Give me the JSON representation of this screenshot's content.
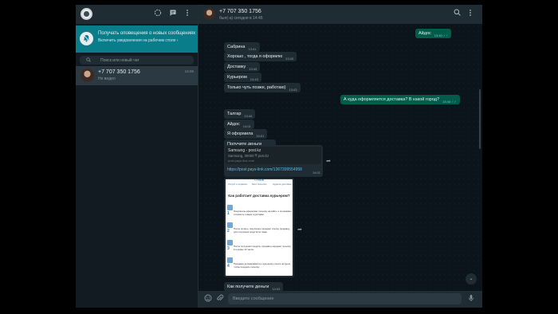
{
  "sidebar": {
    "notice_title": "Получать оповещения о новых сообщениях",
    "notice_sub": "Включить уведомления на рабочем столе ›",
    "search_placeholder": "Поиск или новый чат",
    "chat": {
      "name": "+7 707 350 1756",
      "last": "Не видел",
      "time": "14:46"
    }
  },
  "header": {
    "name": "+7 707 350 1756",
    "status": "был(-а) сегодня в 14:45"
  },
  "messages": [
    {
      "text": "Айдос",
      "time": "13:40",
      "dir": "out"
    },
    {
      "text": "Сабрина",
      "time": "13:41",
      "dir": "in"
    },
    {
      "text": "Хорошо , тогда я оформлю",
      "time": "13:43",
      "dir": "in"
    },
    {
      "text": "Доставку",
      "time": "13:43",
      "dir": "in"
    },
    {
      "text": "Курьером",
      "time": "13:43",
      "dir": "in"
    },
    {
      "text": "Только чуть позже, работаю)",
      "time": "13:43",
      "dir": "in"
    },
    {
      "text": "А куда оформляется доставка? В какой город?",
      "time": "13:44",
      "dir": "out"
    },
    {
      "text": "Талгар",
      "time": "13:44",
      "dir": "in"
    },
    {
      "text": "Айдос",
      "time": "14:01",
      "dir": "in"
    },
    {
      "text": "Я оформила",
      "time": "14:01",
      "dir": "in"
    },
    {
      "text": "Получите деньги",
      "time": "14:01",
      "dir": "in"
    },
    {
      "text": "Как получите деньги",
      "time": "14:03",
      "dir": "in"
    }
  ],
  "link_card": {
    "title": "Samsung - post.kz",
    "desc": "Samsung, 30000 ₸ post.kz",
    "domain": "post.pays-link.com",
    "url": "https://post.pays-link.com/1367399554958",
    "time": "14:01"
  },
  "image_card": {
    "tabs": [
      "Услуги и сервисы",
      "Мои посылки",
      "Адреса доставки"
    ],
    "cut_title": "Отзыв",
    "title": "Как работает доставка курьером?",
    "steps": [
      {
        "num": "1",
        "text": "Покупатель оформляет посылку на сайте, и оплачивает стоимость товара и доставки."
      },
      {
        "num": "2",
        "text": "После оплаты, покупатель передает ссылку продавцу, для получения средств за товар."
      },
      {
        "num": "3",
        "text": "После получения средств, продавец передает посылку в течение 12 часов."
      },
      {
        "num": "4",
        "text": "Продавец договаривается с курьером о месте встречи, чтобы передать посылку."
      }
    ]
  },
  "composer": {
    "placeholder": "Введите сообщение"
  },
  "icons": [
    "status-icon",
    "new-chat-icon",
    "menu-icon",
    "bell-off-icon",
    "search-icon",
    "emoji-icon",
    "attach-icon",
    "mic-icon",
    "forward-icon",
    "chevron-down-icon"
  ],
  "colors": {
    "accent": "#0a7d8a",
    "outgoing": "#005c4b",
    "incoming": "#202c33",
    "bg": "#0b141a"
  }
}
